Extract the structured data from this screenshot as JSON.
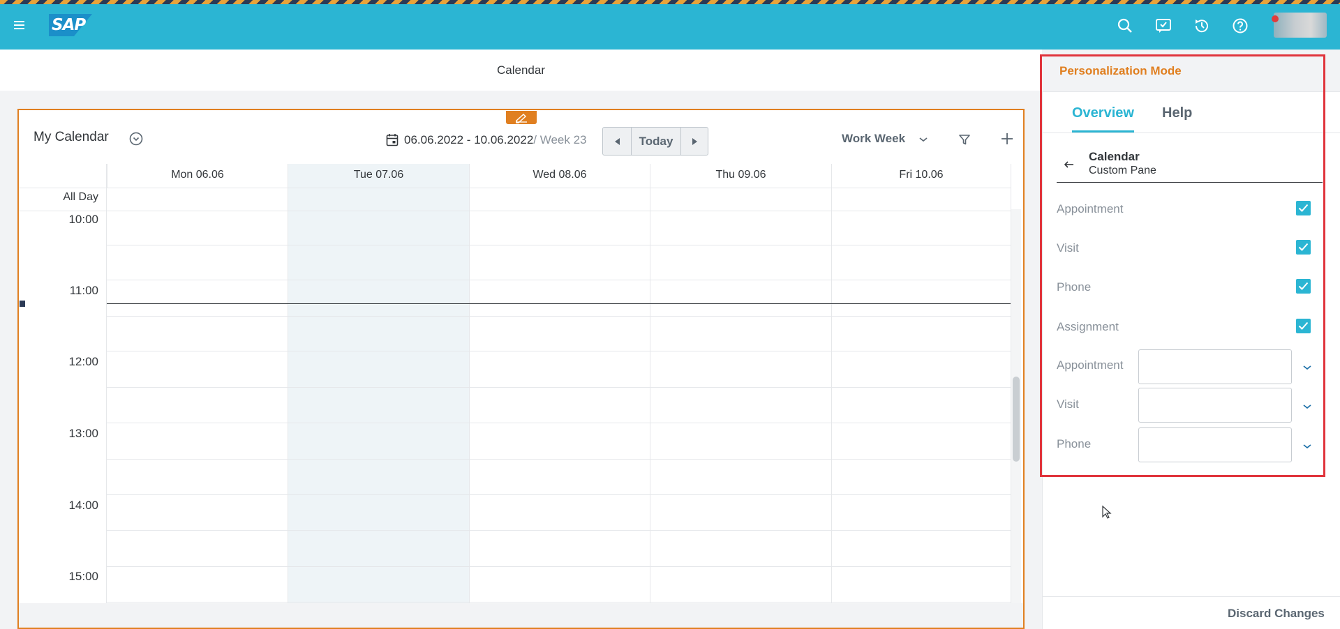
{
  "shell": {
    "logo_text": "SAP",
    "icons": [
      "menu-icon",
      "search-icon",
      "feedback-icon",
      "history-icon",
      "help-icon"
    ]
  },
  "page": {
    "title": "Calendar"
  },
  "calendar": {
    "title": "My Calendar",
    "date_range": "06.06.2022 - 10.06.2022",
    "week": "/ Week 23",
    "today_label": "Today",
    "view": "Work Week",
    "all_day": "All Day",
    "days": [
      "Mon 06.06",
      "Tue 07.06",
      "Wed 08.06",
      "Thu 09.06",
      "Fri 10.06"
    ],
    "times": [
      "10:00",
      "11:00",
      "12:00",
      "13:00",
      "14:00",
      "15:00"
    ]
  },
  "pane": {
    "title": "Personalization Mode",
    "tabs": [
      "Overview",
      "Help"
    ],
    "active_tab": "Overview",
    "breadcrumb_title": "Calendar",
    "breadcrumb_sub": "Custom Pane",
    "checkboxes": [
      {
        "label": "Appointment",
        "checked": true
      },
      {
        "label": "Visit",
        "checked": true
      },
      {
        "label": "Phone",
        "checked": true
      },
      {
        "label": "Assignment",
        "checked": true
      }
    ],
    "selects": [
      {
        "label": "Appointment",
        "value": ""
      },
      {
        "label": "Visit",
        "value": ""
      },
      {
        "label": "Phone",
        "value": ""
      }
    ],
    "discard_label": "Discard Changes"
  },
  "colors": {
    "shell": "#2bb5d3",
    "accent_orange": "#e07f20",
    "highlight_red": "#e0343c",
    "checkbox": "#2bb5d3"
  }
}
